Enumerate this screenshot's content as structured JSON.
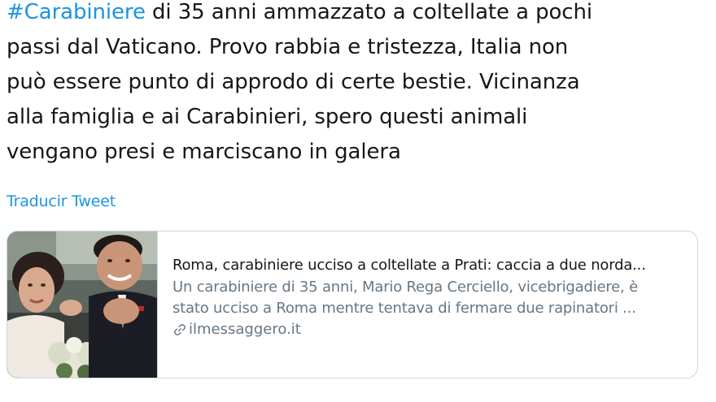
{
  "tweet": {
    "hashtag": "#Carabiniere",
    "lines": [
      " di 35 anni ammazzato a coltellate a pochi",
      "passi dal Vaticano. Provo rabbia e tristezza, Italia non",
      "può essere punto di approdo di certe bestie. Vicinanza",
      "alla famiglia e ai Carabinieri, spero questi animali",
      "vengano presi e marciscano in galera"
    ],
    "translate_label": "Traducir Tweet"
  },
  "card": {
    "title": "Roma, carabiniere ucciso a coltellate a Prati: caccia a due norda...",
    "description_lines": [
      "Un carabiniere di 35 anni, Mario Rega Cerciello, vicebrigadiere, è",
      "stato ucciso a Roma mentre tentava di fermare due rapinatori ..."
    ],
    "domain": "ilmessaggero.it",
    "thumbnail_icon": "wedding-photo-image",
    "domain_icon": "link-icon"
  },
  "colors": {
    "link": "#1b95e0",
    "text": "#14171a",
    "muted": "#657786",
    "border": "#ccd6dd"
  }
}
